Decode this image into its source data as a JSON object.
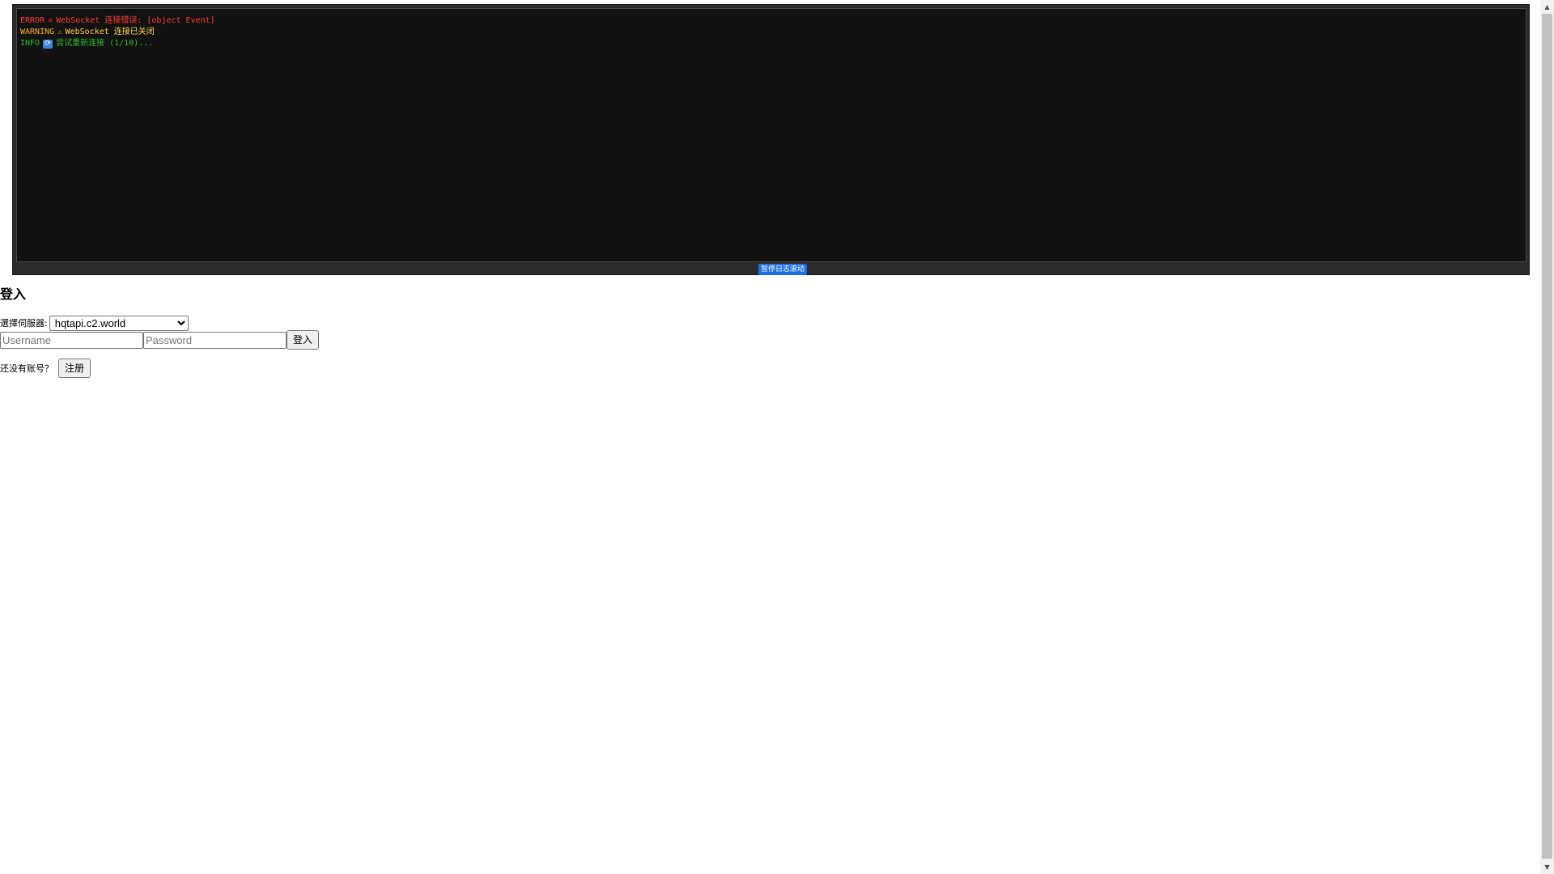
{
  "log_console": {
    "lines": [
      {
        "level": "ERROR",
        "icon": "cross-mark-icon",
        "message": "WebSocket 连接错误: [object Event]",
        "color": "#ff3b30"
      },
      {
        "level": "WARNING",
        "icon": "warning-icon",
        "message": "WebSocket 连接已关闭",
        "color": "#ffb020"
      },
      {
        "level": "INFO",
        "icon": "refresh-icon",
        "message": "尝试重新连接 (1/10)...",
        "color": "#2fb52f"
      }
    ],
    "pause_button_label": "暂停日志滚动",
    "pause_button_color": "#1e6fe0"
  },
  "login": {
    "title": "登入",
    "server_label": "選擇伺服器:",
    "server_selected": "hqtapi.c2.world",
    "username_placeholder": "Username",
    "password_placeholder": "Password",
    "login_button_label": "登入",
    "register_prompt": "还没有账号？",
    "register_button_label": "注册"
  },
  "icons": {
    "warning_glyph": "⚠",
    "cross_glyph": "✕",
    "refresh_glyph": "⟳",
    "scroll_up_glyph": "▲",
    "scroll_down_glyph": "▼"
  }
}
